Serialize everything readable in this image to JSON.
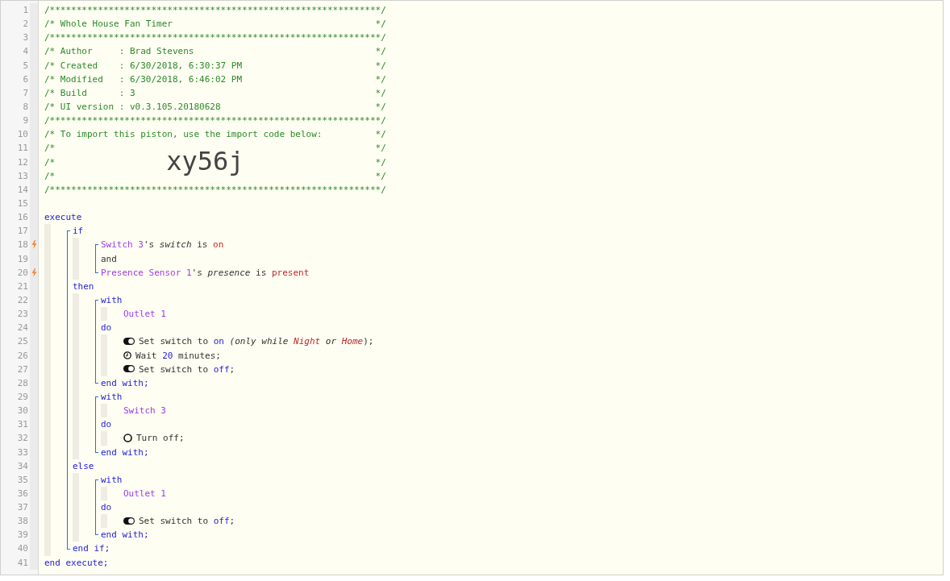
{
  "editor": {
    "lines": [
      {
        "number": "1",
        "kind": "comment",
        "trigger": false,
        "tokens": [
          {
            "kind": "comment",
            "text": "/**************************************************************/"
          }
        ]
      },
      {
        "number": "2",
        "kind": "comment",
        "trigger": false,
        "tokens": [
          {
            "kind": "comment",
            "text": "/* Whole House Fan Timer"
          },
          {
            "kind": "comment",
            "text": "*/"
          }
        ]
      },
      {
        "number": "3",
        "kind": "comment",
        "trigger": false,
        "tokens": [
          {
            "kind": "comment",
            "text": "/**************************************************************/"
          }
        ]
      },
      {
        "number": "4",
        "kind": "comment",
        "trigger": false,
        "tokens": [
          {
            "kind": "comment",
            "text": "/* Author     : Brad Stevens"
          },
          {
            "kind": "comment",
            "text": "*/"
          }
        ]
      },
      {
        "number": "5",
        "kind": "comment",
        "trigger": false,
        "tokens": [
          {
            "kind": "comment",
            "text": "/* Created    : 6/30/2018, 6:30:37 PM"
          },
          {
            "kind": "comment",
            "text": "*/"
          }
        ]
      },
      {
        "number": "6",
        "kind": "comment",
        "trigger": false,
        "tokens": [
          {
            "kind": "comment",
            "text": "/* Modified   : 6/30/2018, 6:46:02 PM"
          },
          {
            "kind": "comment",
            "text": "*/"
          }
        ]
      },
      {
        "number": "7",
        "kind": "comment",
        "trigger": false,
        "tokens": [
          {
            "kind": "comment",
            "text": "/* Build      : 3"
          },
          {
            "kind": "comment",
            "text": "*/"
          }
        ]
      },
      {
        "number": "8",
        "kind": "comment",
        "trigger": false,
        "tokens": [
          {
            "kind": "comment",
            "text": "/* UI version : v0.3.105.20180628"
          },
          {
            "kind": "comment",
            "text": "*/"
          }
        ]
      },
      {
        "number": "9",
        "kind": "comment",
        "trigger": false,
        "tokens": [
          {
            "kind": "comment",
            "text": "/**************************************************************/"
          }
        ]
      },
      {
        "number": "10",
        "kind": "comment",
        "trigger": false,
        "tokens": [
          {
            "kind": "comment",
            "text": "/* To import this piston, use the import code below:"
          },
          {
            "kind": "comment",
            "text": "*/"
          }
        ]
      },
      {
        "number": "11",
        "kind": "comment",
        "trigger": false,
        "tokens": [
          {
            "kind": "comment",
            "text": "/*"
          },
          {
            "kind": "comment",
            "text": "*/"
          }
        ]
      },
      {
        "number": "12",
        "kind": "comment",
        "trigger": false,
        "tokens": [
          {
            "kind": "comment",
            "text": "/*"
          },
          {
            "kind": "import-code",
            "text": "xy56j"
          },
          {
            "kind": "comment",
            "text": "*/"
          }
        ]
      },
      {
        "number": "13",
        "kind": "comment",
        "trigger": false,
        "tokens": [
          {
            "kind": "comment",
            "text": "/*"
          },
          {
            "kind": "comment",
            "text": "*/"
          }
        ]
      },
      {
        "number": "14",
        "kind": "comment",
        "trigger": false,
        "tokens": [
          {
            "kind": "comment",
            "text": "/**************************************************************/"
          }
        ]
      },
      {
        "number": "15",
        "kind": "blank",
        "trigger": false
      },
      {
        "number": "16",
        "kind": "code",
        "trigger": false,
        "tokens": [
          {
            "kind": "keyword",
            "text": "execute"
          }
        ],
        "children": [
          {
            "kind": "group",
            "children": [
              {
                "number": "17",
                "kind": "code",
                "trigger": false,
                "tokens": [
                  {
                    "kind": "keyword",
                    "text": "if"
                  }
                ],
                "children": [
                  {
                    "kind": "group",
                    "children": [
                      {
                        "number": "18",
                        "kind": "code",
                        "trigger": true,
                        "tokens": [
                          {
                            "kind": "device",
                            "text": "Switch 3"
                          },
                          {
                            "kind": "text",
                            "text": "'s",
                            "tight": true
                          },
                          {
                            "kind": "attribute",
                            "text": "switch"
                          },
                          {
                            "kind": "text",
                            "text": "is"
                          },
                          {
                            "kind": "value",
                            "text": "on"
                          }
                        ]
                      },
                      {
                        "number": "19",
                        "kind": "code",
                        "trigger": false,
                        "tokens": [
                          {
                            "kind": "text",
                            "text": "and"
                          }
                        ]
                      },
                      {
                        "number": "20",
                        "kind": "code",
                        "trigger": true,
                        "tokens": [
                          {
                            "kind": "device",
                            "text": "Presence Sensor 1"
                          },
                          {
                            "kind": "text",
                            "text": "'s",
                            "tight": true
                          },
                          {
                            "kind": "attribute",
                            "text": "presence"
                          },
                          {
                            "kind": "text",
                            "text": "is"
                          },
                          {
                            "kind": "value",
                            "text": "present"
                          }
                        ]
                      }
                    ]
                  }
                ]
              },
              {
                "number": "21",
                "kind": "code",
                "trigger": false,
                "tokens": [
                  {
                    "kind": "keyword",
                    "text": "then"
                  }
                ],
                "children": [
                  {
                    "kind": "group",
                    "children": [
                      {
                        "number": "22",
                        "kind": "code",
                        "trigger": false,
                        "tokens": [
                          {
                            "kind": "keyword",
                            "text": "with"
                          }
                        ],
                        "children": [
                          {
                            "number": "23",
                            "kind": "code",
                            "trigger": false,
                            "tokens": [
                              {
                                "kind": "device",
                                "text": "Outlet 1"
                              }
                            ]
                          }
                        ]
                      },
                      {
                        "number": "24",
                        "kind": "code",
                        "trigger": false,
                        "tokens": [
                          {
                            "kind": "keyword",
                            "text": "do"
                          }
                        ],
                        "children": [
                          {
                            "number": "25",
                            "kind": "switch",
                            "trigger": false,
                            "tokens": [
                              {
                                "kind": "text",
                                "text": "Set switch to"
                              },
                              {
                                "kind": "operand",
                                "text": "on"
                              },
                              {
                                "kind": "note",
                                "text": "(only while"
                              },
                              {
                                "kind": "note-value",
                                "text": "Night"
                              },
                              {
                                "kind": "note",
                                "text": "or"
                              },
                              {
                                "kind": "note-value",
                                "text": "Home"
                              },
                              {
                                "kind": "text",
                                "text": ");",
                                "tight": true
                              }
                            ]
                          },
                          {
                            "number": "26",
                            "kind": "wait",
                            "trigger": false,
                            "tokens": [
                              {
                                "kind": "text",
                                "text": "Wait"
                              },
                              {
                                "kind": "operand",
                                "text": "20"
                              },
                              {
                                "kind": "text",
                                "text": "minutes;"
                              }
                            ]
                          },
                          {
                            "number": "27",
                            "kind": "switch",
                            "trigger": false,
                            "tokens": [
                              {
                                "kind": "text",
                                "text": "Set switch to"
                              },
                              {
                                "kind": "operand",
                                "text": "off"
                              },
                              {
                                "kind": "text",
                                "text": ";",
                                "tight": true
                              }
                            ]
                          }
                        ]
                      },
                      {
                        "number": "28",
                        "kind": "code",
                        "trigger": false,
                        "tokens": [
                          {
                            "kind": "keyword",
                            "text": "end with;"
                          }
                        ]
                      }
                    ]
                  },
                  {
                    "kind": "group",
                    "children": [
                      {
                        "number": "29",
                        "kind": "code",
                        "trigger": false,
                        "tokens": [
                          {
                            "kind": "keyword",
                            "text": "with"
                          }
                        ],
                        "children": [
                          {
                            "number": "30",
                            "kind": "code",
                            "trigger": false,
                            "tokens": [
                              {
                                "kind": "device",
                                "text": "Switch 3"
                              }
                            ]
                          }
                        ]
                      },
                      {
                        "number": "31",
                        "kind": "code",
                        "trigger": false,
                        "tokens": [
                          {
                            "kind": "keyword",
                            "text": "do"
                          }
                        ],
                        "children": [
                          {
                            "number": "32",
                            "kind": "command",
                            "trigger": false,
                            "tokens": [
                              {
                                "kind": "text",
                                "text": "Turn off;"
                              }
                            ]
                          }
                        ]
                      },
                      {
                        "number": "33",
                        "kind": "code",
                        "trigger": false,
                        "tokens": [
                          {
                            "kind": "keyword",
                            "text": "end with;"
                          }
                        ]
                      }
                    ]
                  }
                ]
              },
              {
                "number": "34",
                "kind": "code",
                "trigger": false,
                "tokens": [
                  {
                    "kind": "keyword",
                    "text": "else"
                  }
                ],
                "children": [
                  {
                    "kind": "group",
                    "children": [
                      {
                        "number": "35",
                        "kind": "code",
                        "trigger": false,
                        "tokens": [
                          {
                            "kind": "keyword",
                            "text": "with"
                          }
                        ],
                        "children": [
                          {
                            "number": "36",
                            "kind": "code",
                            "trigger": false,
                            "tokens": [
                              {
                                "kind": "device",
                                "text": "Outlet 1"
                              }
                            ]
                          }
                        ]
                      },
                      {
                        "number": "37",
                        "kind": "code",
                        "trigger": false,
                        "tokens": [
                          {
                            "kind": "keyword",
                            "text": "do"
                          }
                        ],
                        "children": [
                          {
                            "number": "38",
                            "kind": "switch",
                            "trigger": false,
                            "tokens": [
                              {
                                "kind": "text",
                                "text": "Set switch to"
                              },
                              {
                                "kind": "operand",
                                "text": "off"
                              },
                              {
                                "kind": "text",
                                "text": ";",
                                "tight": true
                              }
                            ]
                          }
                        ]
                      },
                      {
                        "number": "39",
                        "kind": "code",
                        "trigger": false,
                        "tokens": [
                          {
                            "kind": "keyword",
                            "text": "end with;"
                          }
                        ]
                      }
                    ]
                  }
                ]
              },
              {
                "number": "40",
                "kind": "code",
                "trigger": false,
                "tokens": [
                  {
                    "kind": "keyword",
                    "text": "end if;"
                  }
                ]
              }
            ]
          }
        ]
      },
      {
        "number": "41",
        "kind": "code",
        "trigger": false,
        "tokens": [
          {
            "kind": "keyword",
            "text": "end execute;"
          }
        ]
      }
    ]
  }
}
